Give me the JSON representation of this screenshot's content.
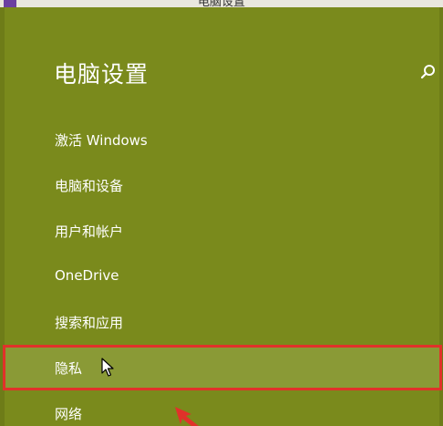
{
  "window": {
    "title": "电脑设置",
    "app_icon": "settings-app-icon"
  },
  "header": {
    "title": "电脑设置",
    "search_icon": "search-icon"
  },
  "menu": {
    "items": [
      {
        "label": "激活 Windows"
      },
      {
        "label": "电脑和设备"
      },
      {
        "label": "用户和帐户"
      },
      {
        "label": "OneDrive"
      },
      {
        "label": "搜索和应用"
      },
      {
        "label": "隐私",
        "highlighted": true
      },
      {
        "label": "网络"
      }
    ]
  },
  "colors": {
    "background": "#7a8a1c",
    "highlight_background": "#8a9a36",
    "highlight_border": "#e0322a",
    "text": "#ffffff"
  },
  "annotations": {
    "pointer": "mouse-cursor",
    "arrow": "red-arrow-annotation"
  }
}
